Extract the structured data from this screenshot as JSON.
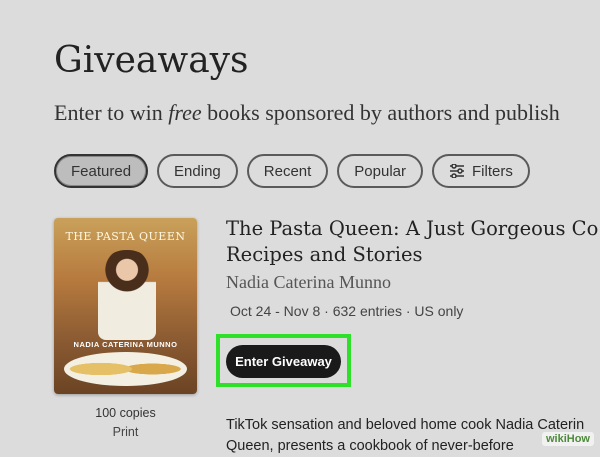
{
  "header": {
    "title": "Giveaways",
    "subtitle_before": "Enter to win ",
    "subtitle_em": "free",
    "subtitle_after": " books sponsored by authors and publish"
  },
  "filters": [
    {
      "label": "Featured",
      "active": true
    },
    {
      "label": "Ending"
    },
    {
      "label": "Recent"
    },
    {
      "label": "Popular"
    },
    {
      "label": "Filters",
      "icon": "sliders-icon"
    }
  ],
  "giveaway": {
    "cover": {
      "title": "THE PASTA QUEEN",
      "author": "NADIA CATERINA MUNNO"
    },
    "title_line1": "The Pasta Queen: A Just Gorgeous Co",
    "title_line2": "Recipes and Stories",
    "author": "Nadia Caterina Munno",
    "meta": "Oct 24 - Nov 8 · 632 entries · US only",
    "button_label": "Enter Giveaway",
    "copies": "100 copies",
    "format": "Print",
    "description_line1": "TikTok sensation and beloved home cook Nadia Caterin",
    "description_line2": "Queen, presents a cookbook of never-before"
  },
  "watermark": "wikiHow",
  "colors": {
    "background": "#dcdcdc",
    "highlight": "#2ee02a",
    "button": "#1a1a1a"
  }
}
